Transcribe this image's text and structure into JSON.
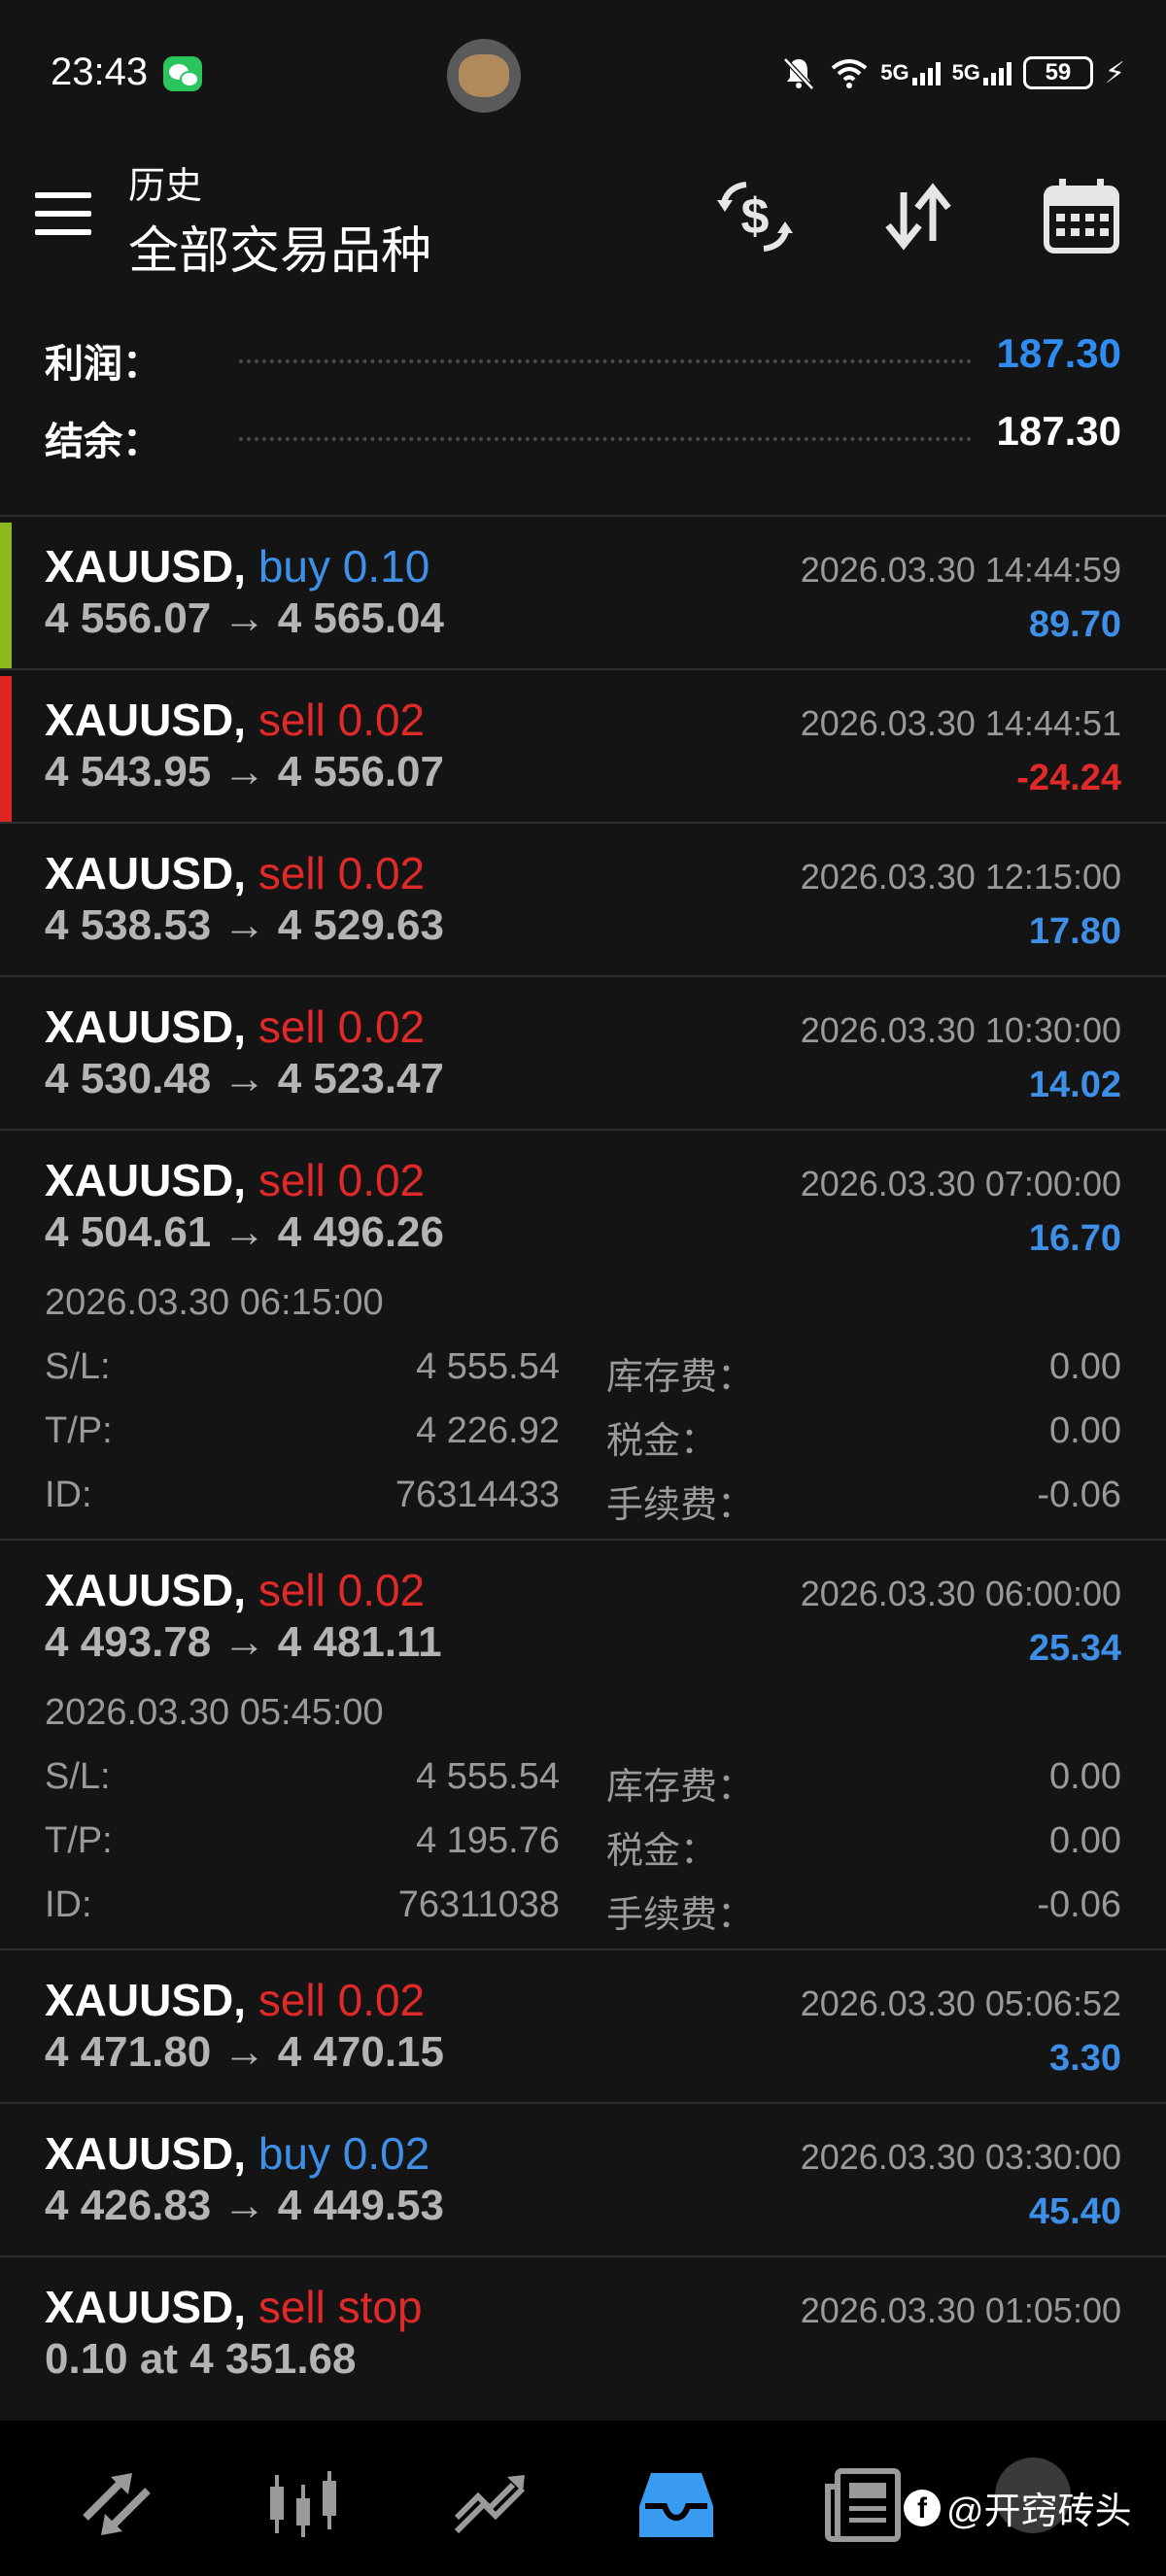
{
  "status_bar": {
    "time": "23:43",
    "battery": "59",
    "net1": "5G",
    "net2": "5G"
  },
  "header": {
    "subtitle": "历史",
    "title": "全部交易品种"
  },
  "summary": {
    "profit_label": "利润：",
    "profit_value": "187.30",
    "balance_label": "结余：",
    "balance_value": "187.30"
  },
  "deals": [
    {
      "symbol": "XAUUSD,",
      "type": "buy 0.10",
      "side": "buy",
      "prices": "4 556.07 → 4 565.04",
      "time": "2026.03.30 14:44:59",
      "profit": "89.70",
      "positive": true,
      "bar": "#8cb81e"
    },
    {
      "symbol": "XAUUSD,",
      "type": "sell 0.02",
      "side": "sell",
      "prices": "4 543.95 → 4 556.07",
      "time": "2026.03.30 14:44:51",
      "profit": "-24.24",
      "positive": false,
      "bar": "#e02424"
    },
    {
      "symbol": "XAUUSD,",
      "type": "sell 0.02",
      "side": "sell",
      "prices": "4 538.53 → 4 529.63",
      "time": "2026.03.30 12:15:00",
      "profit": "17.80",
      "positive": true
    },
    {
      "symbol": "XAUUSD,",
      "type": "sell 0.02",
      "side": "sell",
      "prices": "4 530.48 → 4 523.47",
      "time": "2026.03.30 10:30:00",
      "profit": "14.02",
      "positive": true
    },
    {
      "symbol": "XAUUSD,",
      "type": "sell 0.02",
      "side": "sell",
      "prices": "4 504.61 → 4 496.26",
      "time": "2026.03.30 07:00:00",
      "profit": "16.70",
      "positive": true,
      "expanded": {
        "open_time": "2026.03.30 06:15:00",
        "sl_label": "S/L:",
        "sl": "4 555.54",
        "tp_label": "T/P:",
        "tp": "4 226.92",
        "id_label": "ID:",
        "id": "76314433",
        "swap_label": "库存费：",
        "swap": "0.00",
        "tax_label": "税金：",
        "tax": "0.00",
        "fee_label": "手续费：",
        "fee": "-0.06"
      }
    },
    {
      "symbol": "XAUUSD,",
      "type": "sell 0.02",
      "side": "sell",
      "prices": "4 493.78 → 4 481.11",
      "time": "2026.03.30 06:00:00",
      "profit": "25.34",
      "positive": true,
      "expanded": {
        "open_time": "2026.03.30 05:45:00",
        "sl_label": "S/L:",
        "sl": "4 555.54",
        "tp_label": "T/P:",
        "tp": "4 195.76",
        "id_label": "ID:",
        "id": "76311038",
        "swap_label": "库存费：",
        "swap": "0.00",
        "tax_label": "税金：",
        "tax": "0.00",
        "fee_label": "手续费：",
        "fee": "-0.06"
      }
    },
    {
      "symbol": "XAUUSD,",
      "type": "sell 0.02",
      "side": "sell",
      "prices": "4 471.80 → 4 470.15",
      "time": "2026.03.30 05:06:52",
      "profit": "3.30",
      "positive": true
    },
    {
      "symbol": "XAUUSD,",
      "type": "buy 0.02",
      "side": "buy",
      "prices": "4 426.83 → 4 449.53",
      "time": "2026.03.30 03:30:00",
      "profit": "45.40",
      "positive": true
    },
    {
      "symbol": "XAUUSD,",
      "type": "sell stop",
      "side": "sell",
      "prices": "0.10 at 4 351.68",
      "time": "2026.03.30 01:05:00",
      "profit": "",
      "positive": true
    }
  ],
  "nav": [
    "quotes-icon",
    "chart-icon",
    "trade-icon",
    "history-icon",
    "news-icon"
  ],
  "watermark": "@开窍砖头",
  "colors": {
    "buy": "#3d8fe8",
    "sell": "#e02a2a",
    "profit_pos": "#3d8fe8",
    "profit_neg": "#e02a2a",
    "profit_total": "#2f8cf0",
    "active_nav": "#3a9cf0"
  }
}
